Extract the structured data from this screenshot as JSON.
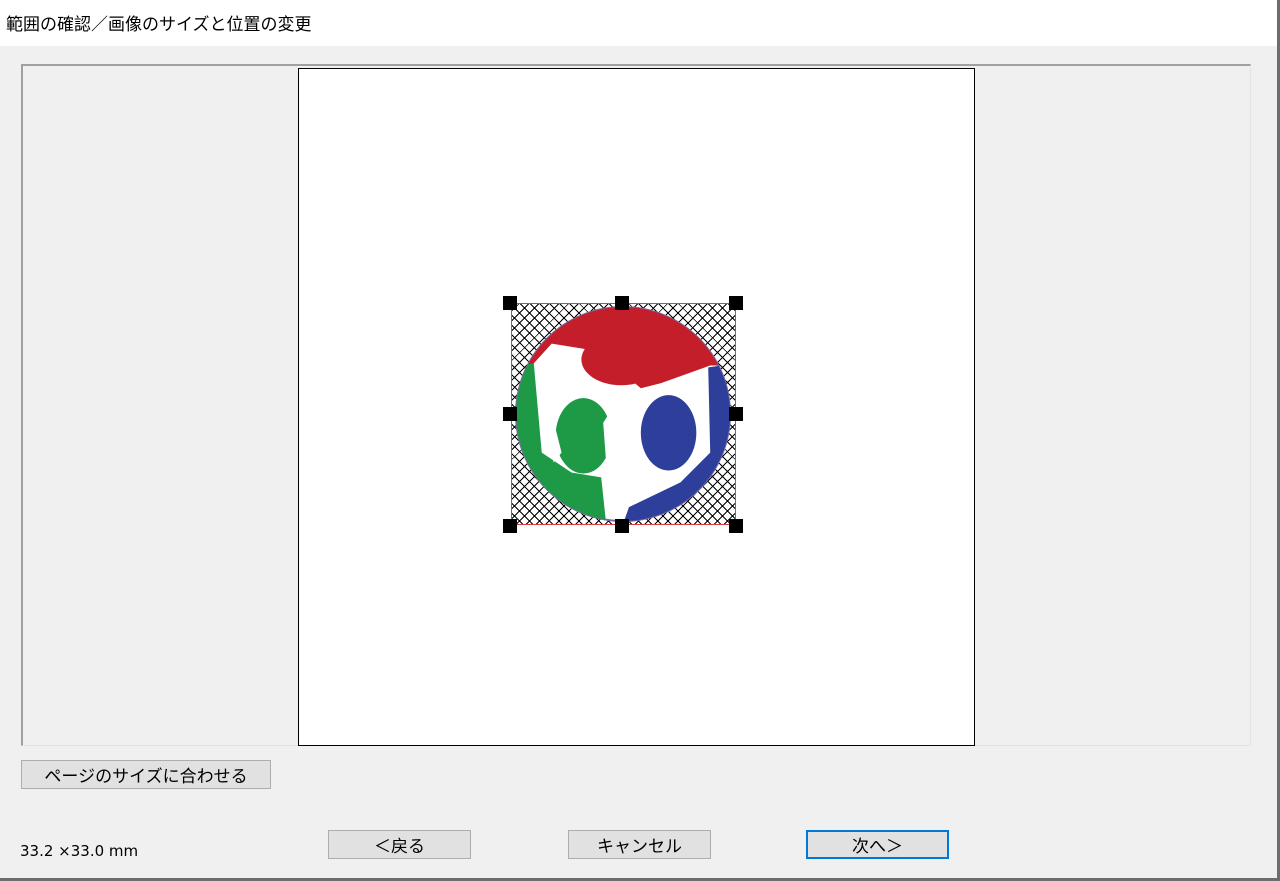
{
  "window": {
    "title": "範囲の確認／画像のサイズと位置の変更"
  },
  "preview": {
    "image": {
      "description_icon": "fsij-logo-icon",
      "colors": {
        "red": "#c41e2a",
        "green": "#1e9a47",
        "blue": "#2d3f9a"
      }
    }
  },
  "buttons": {
    "fit_page": "ページのサイズに合わせる",
    "back": "＜戻る",
    "cancel": "キャンセル",
    "next": "次へ＞"
  },
  "status": {
    "size": "33.2 ×33.0 mm"
  }
}
